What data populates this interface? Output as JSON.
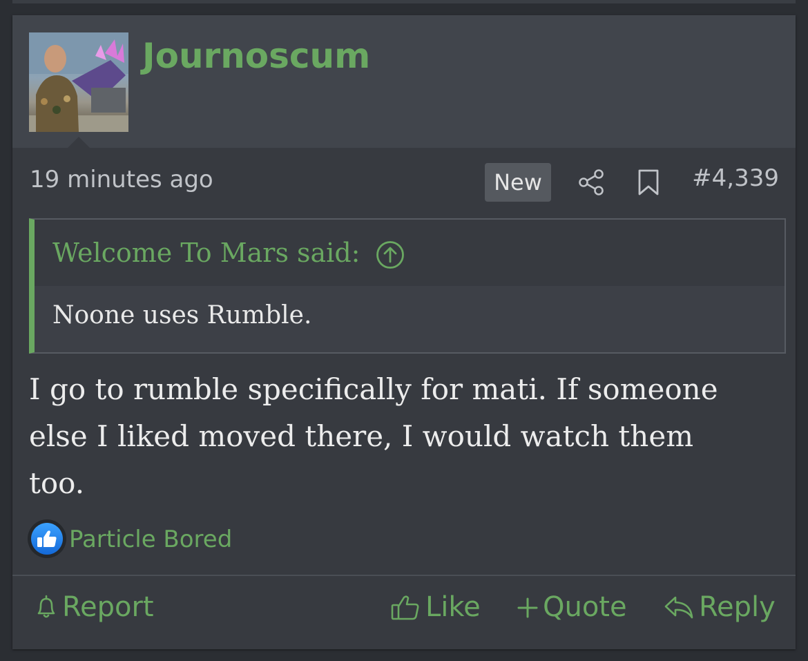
{
  "post": {
    "username": "Journoscum",
    "timestamp": "19 minutes ago",
    "badge": "New",
    "post_number": "#4,339",
    "icons": [
      "share-icon",
      "bookmark-icon"
    ],
    "quote": {
      "author_line": "Welcome To Mars said:",
      "body": "Noone uses Rumble.",
      "icon": "arrow-up-circle-icon"
    },
    "message_lines": [
      "I go to rumble specifically for mati. If someone",
      "else I liked moved there, I would watch them",
      "too."
    ],
    "reactions": {
      "icon": "thumbs-up-icon",
      "users": "Particle Bored"
    },
    "actions": {
      "report": "Report",
      "like": "Like",
      "quote": "Quote",
      "reply": "Reply"
    }
  },
  "colors": {
    "accent": "#6aa861",
    "background": "#373a40",
    "header_bg": "#41454c"
  }
}
